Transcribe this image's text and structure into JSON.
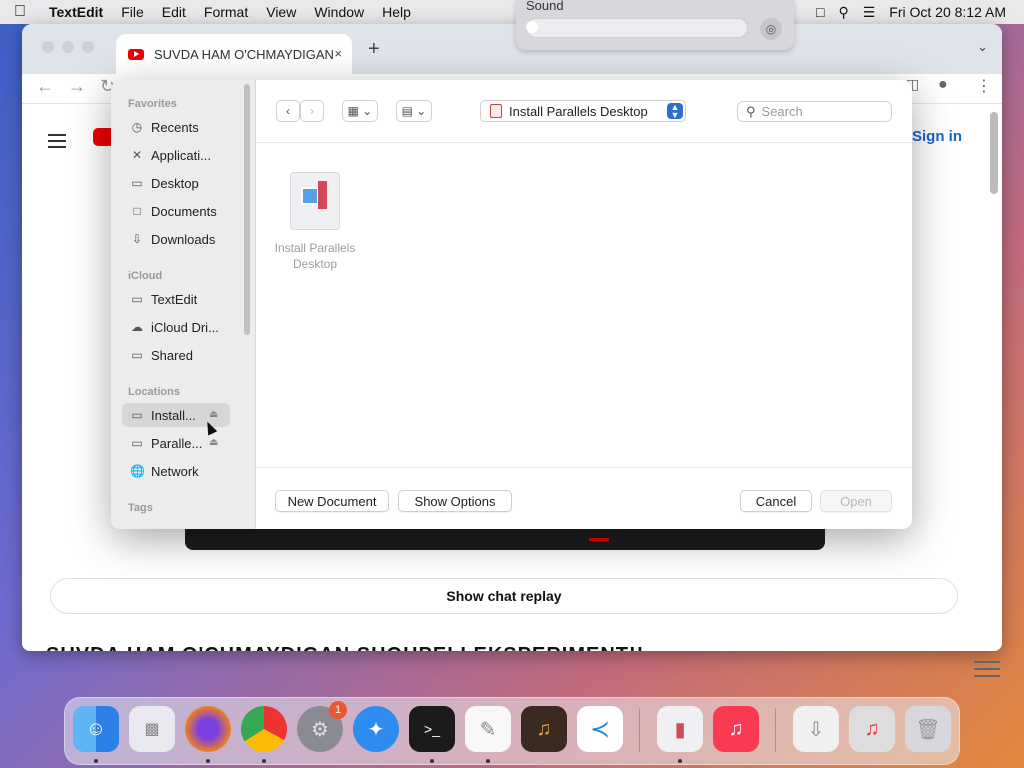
{
  "menubar": {
    "app_name": "TextEdit",
    "items": [
      "File",
      "Edit",
      "Format",
      "View",
      "Window",
      "Help"
    ],
    "clock": "Fri Oct 20  8:12 AM"
  },
  "sound_control": {
    "title": "Sound",
    "volume_level": 0.02
  },
  "browser": {
    "tab_title": "SUVDA HAM O'CHMAYDIGAN",
    "tab_close": "×",
    "new_tab": "+",
    "sign_in": "Sign in",
    "chat_replay": "Show chat replay",
    "video_title": "SUVDA HAM O'CHMAYDIGAN SHOHPELI EKSPERIMENT!!"
  },
  "dialog": {
    "sidebar": {
      "favorites_header": "Favorites",
      "favorites": [
        {
          "label": "Recents",
          "icon": "clock-icon"
        },
        {
          "label": "Applicati...",
          "icon": "applications-icon"
        },
        {
          "label": "Desktop",
          "icon": "desktop-icon"
        },
        {
          "label": "Documents",
          "icon": "document-icon"
        },
        {
          "label": "Downloads",
          "icon": "download-icon"
        }
      ],
      "icloud_header": "iCloud",
      "icloud": [
        {
          "label": "TextEdit",
          "icon": "folder-icon"
        },
        {
          "label": "iCloud Dri...",
          "icon": "cloud-icon"
        },
        {
          "label": "Shared",
          "icon": "shared-folder-icon"
        }
      ],
      "locations_header": "Locations",
      "locations": [
        {
          "label": "Install...",
          "icon": "drive-icon",
          "selected": true
        },
        {
          "label": "Paralle...",
          "icon": "drive-icon",
          "selected": false
        },
        {
          "label": "Network",
          "icon": "globe-icon",
          "selected": false
        }
      ],
      "tags_header": "Tags"
    },
    "location": "Install Parallels Desktop",
    "search_placeholder": "Search",
    "file": {
      "name": "Install Parallels Desktop"
    },
    "buttons": {
      "new_document": "New Document",
      "show_options": "Show Options",
      "cancel": "Cancel",
      "open": "Open"
    }
  },
  "dock": {
    "items": [
      "Finder",
      "Launchpad",
      "Firefox",
      "Chrome",
      "System Settings",
      "Safari",
      "Terminal",
      "TextEdit",
      "GarageBand",
      "Visual Studio Code",
      "Parallels Desktop",
      "Music",
      "Downloads",
      "Music Stack",
      "Trash"
    ],
    "settings_badge": "1"
  }
}
